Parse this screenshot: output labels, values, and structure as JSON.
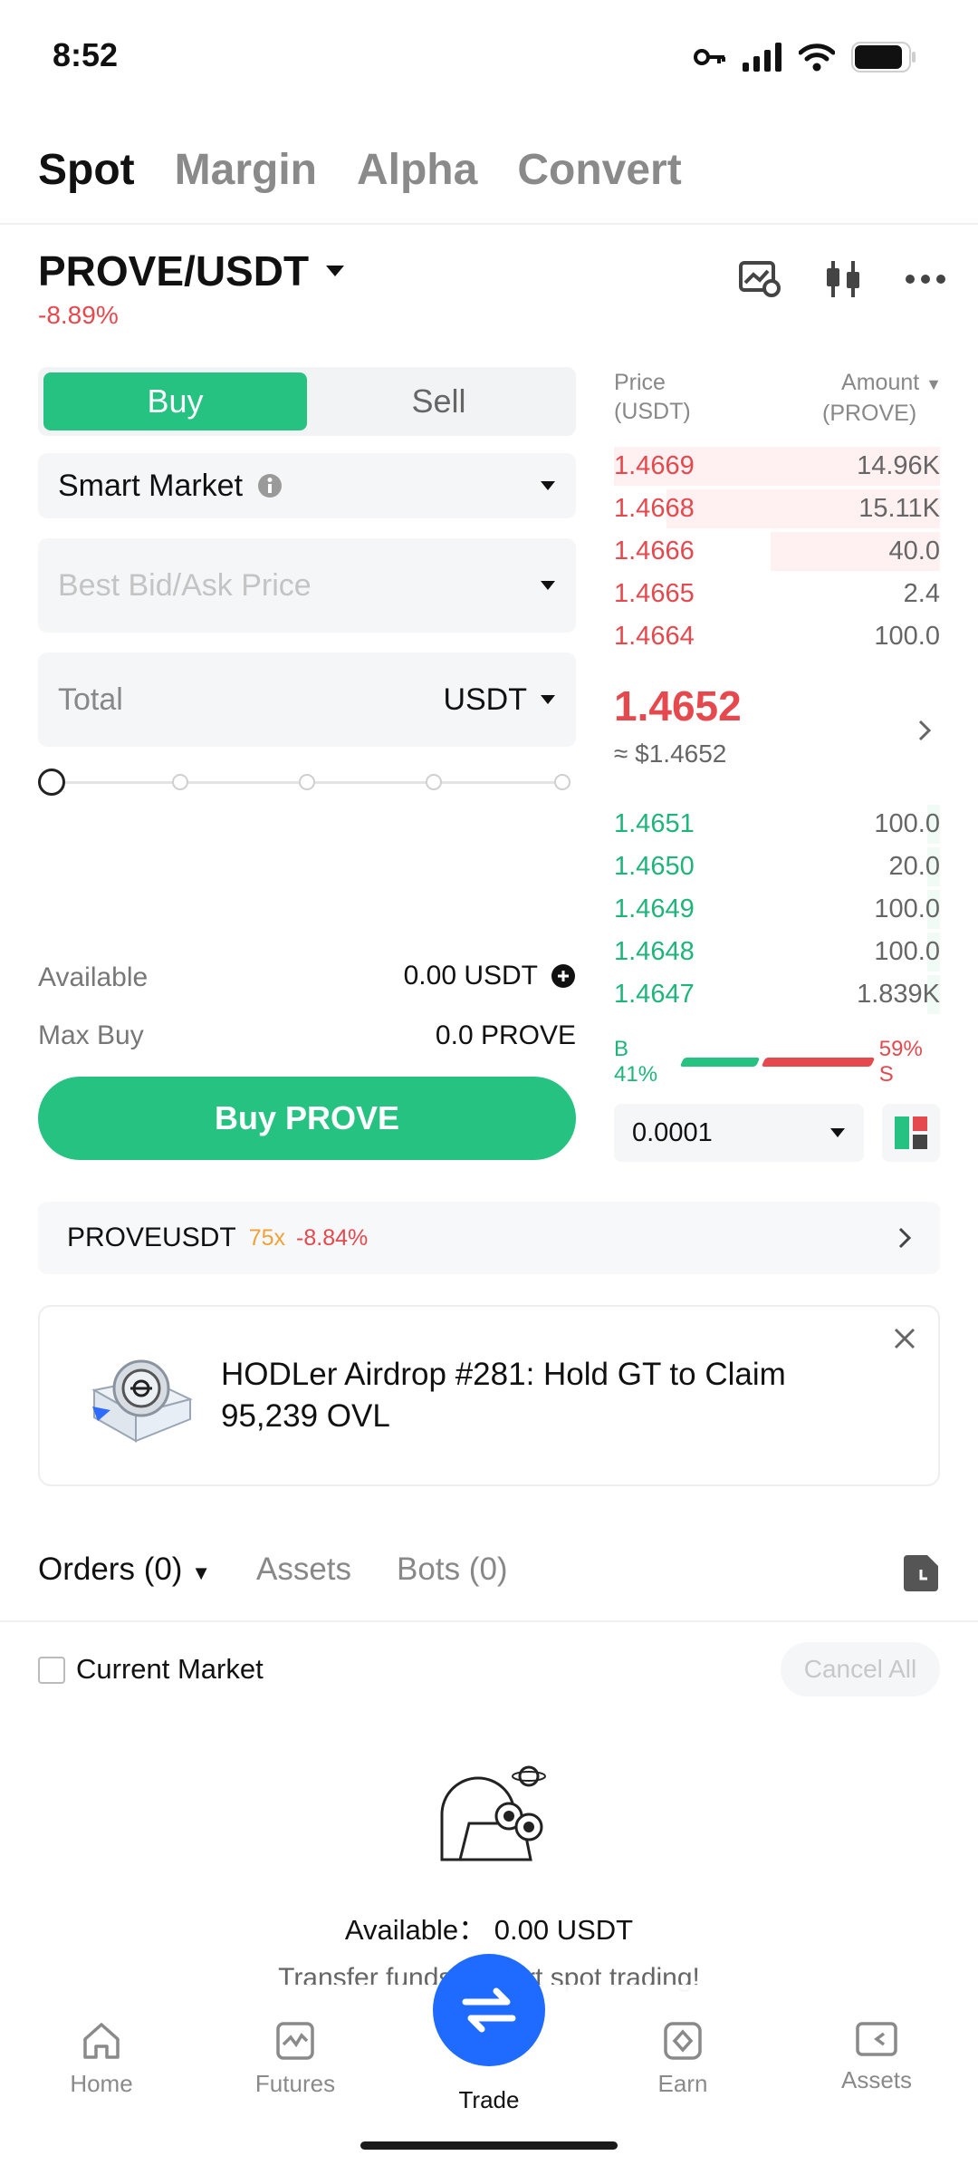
{
  "status_bar": {
    "time": "8:52"
  },
  "top_tabs": [
    {
      "label": "Spot",
      "active": true
    },
    {
      "label": "Margin",
      "active": false
    },
    {
      "label": "Alpha",
      "active": false
    },
    {
      "label": "Convert",
      "active": false
    }
  ],
  "pair": {
    "name": "PROVE/USDT",
    "change": "-8.89%"
  },
  "order_form": {
    "buy_label": "Buy",
    "sell_label": "Sell",
    "order_type": "Smart Market",
    "price_placeholder": "Best Bid/Ask Price",
    "total_placeholder": "Total",
    "total_unit": "USDT",
    "slider_fraction": 0,
    "available_label": "Available",
    "available_value": "0.00 USDT",
    "maxbuy_label": "Max Buy",
    "maxbuy_value": "0.0 PROVE",
    "submit_label": "Buy PROVE"
  },
  "order_book": {
    "price_header": "Price",
    "price_unit": "(USDT)",
    "amount_header": "Amount",
    "amount_unit": "(PROVE)",
    "asks": [
      {
        "price": "1.4669",
        "amount": "14.96K",
        "depth": 1.0
      },
      {
        "price": "1.4668",
        "amount": "15.11K",
        "depth": 0.84
      },
      {
        "price": "1.4666",
        "amount": "40.0",
        "depth": 0.52
      },
      {
        "price": "1.4665",
        "amount": "2.4",
        "depth": 0
      },
      {
        "price": "1.4664",
        "amount": "100.0",
        "depth": 0
      }
    ],
    "last_price": "1.4652",
    "last_price_usd": "≈ $1.4652",
    "bids": [
      {
        "price": "1.4651",
        "amount": "100.0",
        "depth": 0.04
      },
      {
        "price": "1.4650",
        "amount": "20.0",
        "depth": 0.04
      },
      {
        "price": "1.4649",
        "amount": "100.0",
        "depth": 0.04
      },
      {
        "price": "1.4648",
        "amount": "100.0",
        "depth": 0.04
      },
      {
        "price": "1.4647",
        "amount": "1.839K",
        "depth": 0.04
      }
    ],
    "buy_ratio_label": "B 41%",
    "sell_ratio_label": "59% S",
    "buy_ratio": 0.41,
    "precision": "0.0001"
  },
  "futures_bar": {
    "symbol": "PROVEUSDT",
    "leverage": "75x",
    "change": "-8.84%"
  },
  "banner": {
    "text": "HODLer Airdrop #281: Hold GT to Claim 95,239 OVL"
  },
  "orders": {
    "tabs": [
      {
        "label": "Orders (0)",
        "active": true
      },
      {
        "label": "Assets",
        "active": false
      },
      {
        "label": "Bots (0)",
        "active": false
      }
    ],
    "current_market_label": "Current Market",
    "cancel_all_label": "Cancel All",
    "empty_available": "Available： 0.00 USDT",
    "empty_transfer": "Transfer funds to start spot trading!"
  },
  "bottom_nav": [
    {
      "label": "Home",
      "icon": "home-icon"
    },
    {
      "label": "Futures",
      "icon": "futures-icon"
    },
    {
      "label": "Trade",
      "icon": "trade-swap-icon",
      "active": true
    },
    {
      "label": "Earn",
      "icon": "earn-icon"
    },
    {
      "label": "Assets",
      "icon": "assets-icon"
    }
  ],
  "colors": {
    "buy_green": "#26c281",
    "sell_red": "#e5484d",
    "fab_blue": "#1f6bff"
  }
}
